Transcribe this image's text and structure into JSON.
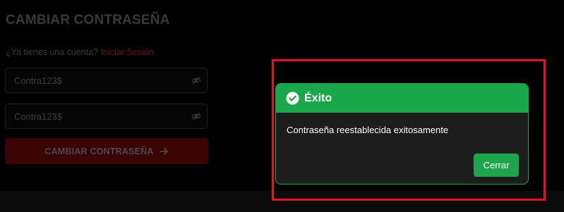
{
  "form": {
    "title": "CAMBIAR CONTRASEÑA",
    "login_prompt": "¿Ya tienes una cuenta?",
    "login_link": "Iniciar Sesión",
    "password_value": "Contra123$",
    "confirm_value": "Contra123$",
    "submit_label": "CAMBIAR CONTRASEÑA",
    "eye_icon": "eye-off-icon",
    "arrow_icon": "arrow-right-icon"
  },
  "modal": {
    "title": "Éxito",
    "message": "Contraseña reestablecida exitosamente",
    "close_label": "Cerrar",
    "icon": "check-circle-icon"
  },
  "colors": {
    "background": "#000000",
    "success_green": "#1aa64a",
    "highlight_red": "#e8131f",
    "dim_red": "#3b0404"
  }
}
